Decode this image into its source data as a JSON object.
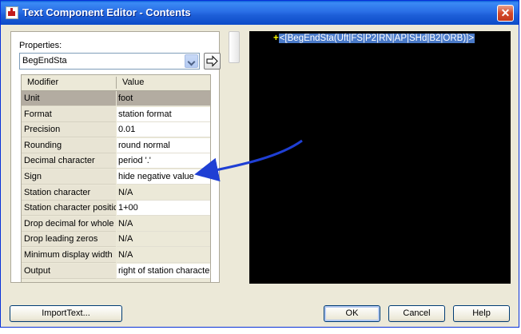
{
  "window": {
    "title": "Text Component Editor - Contents"
  },
  "properties": {
    "label": "Properties:",
    "selected": "BegEndSta",
    "columns": [
      "Modifier",
      "Value"
    ],
    "rows": [
      {
        "modifier": "Unit",
        "value": "foot"
      },
      {
        "modifier": "Format",
        "value": "station format"
      },
      {
        "modifier": "Precision",
        "value": "0.01"
      },
      {
        "modifier": "Rounding",
        "value": "round normal"
      },
      {
        "modifier": "Decimal character",
        "value": "period '.'"
      },
      {
        "modifier": "Sign",
        "value": "hide negative value"
      },
      {
        "modifier": "Station character",
        "value": "N/A"
      },
      {
        "modifier": "Station character positic",
        "value": "1+00"
      },
      {
        "modifier": "Drop decimal for whole r",
        "value": "N/A"
      },
      {
        "modifier": "Drop leading zeros",
        "value": "N/A"
      },
      {
        "modifier": "Minimum display width",
        "value": "N/A"
      },
      {
        "modifier": "Output",
        "value": "right of station characte"
      }
    ]
  },
  "preview": {
    "caret": "+",
    "expression": "<[BegEndSta(Uft|FS|P2|RN|AP|SHd|B2|ORB)]>"
  },
  "buttons": {
    "import": "ImportText...",
    "ok": "OK",
    "cancel": "Cancel",
    "help": "Help"
  },
  "colors": {
    "title_bar": "#2a6fe6",
    "preview_background": "#000000",
    "selection_highlight": "#4a7ac8",
    "selected_row": "#b3aca1",
    "annotation_arrow": "#1f3fd4"
  }
}
